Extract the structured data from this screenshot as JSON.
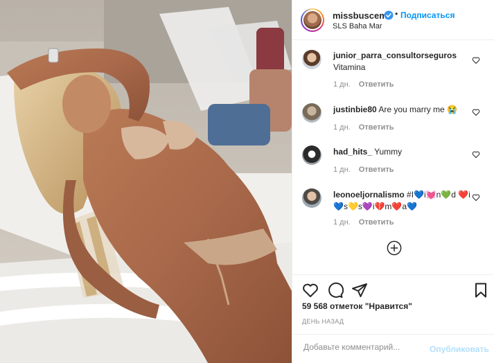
{
  "post": {
    "author": "missbuscemi",
    "follow_label": "Подписаться",
    "dot": "•",
    "location": "SLS Baha Mar"
  },
  "comments": [
    {
      "user": "junior_parra_consultorseguros",
      "text": "Vitamina",
      "age": "1 дн.",
      "reply": "Ответить"
    },
    {
      "user": "justinbie80",
      "text": "Are you marry me 😭",
      "age": "1 дн.",
      "reply": "Ответить"
    },
    {
      "user": "had_hits_",
      "text": "Yummy",
      "age": "1 дн.",
      "reply": "Ответить"
    },
    {
      "user": "leonoeljornalismo",
      "text": "#I💙i💓n💚d ❤️i💙s💛s💜i💔m❤️a💙",
      "age": "1 дн.",
      "reply": "Ответить"
    }
  ],
  "likes_label": "59 568 отметок \"Нравится\"",
  "posted_time": "ДЕНЬ НАЗАД",
  "comment_box": {
    "placeholder": "Добавьте комментарий...",
    "publish_label": "Опубликовать"
  },
  "icons": {
    "verified": "verified-badge-icon",
    "like": "heart-icon",
    "comment": "comment-bubble-icon",
    "share": "paper-plane-icon",
    "save": "bookmark-icon",
    "load_more": "plus-circle-icon"
  },
  "colors": {
    "accent": "#0095f6",
    "text": "#262626",
    "muted": "#8e8e8e",
    "publish_disabled": "#b2dffc"
  }
}
